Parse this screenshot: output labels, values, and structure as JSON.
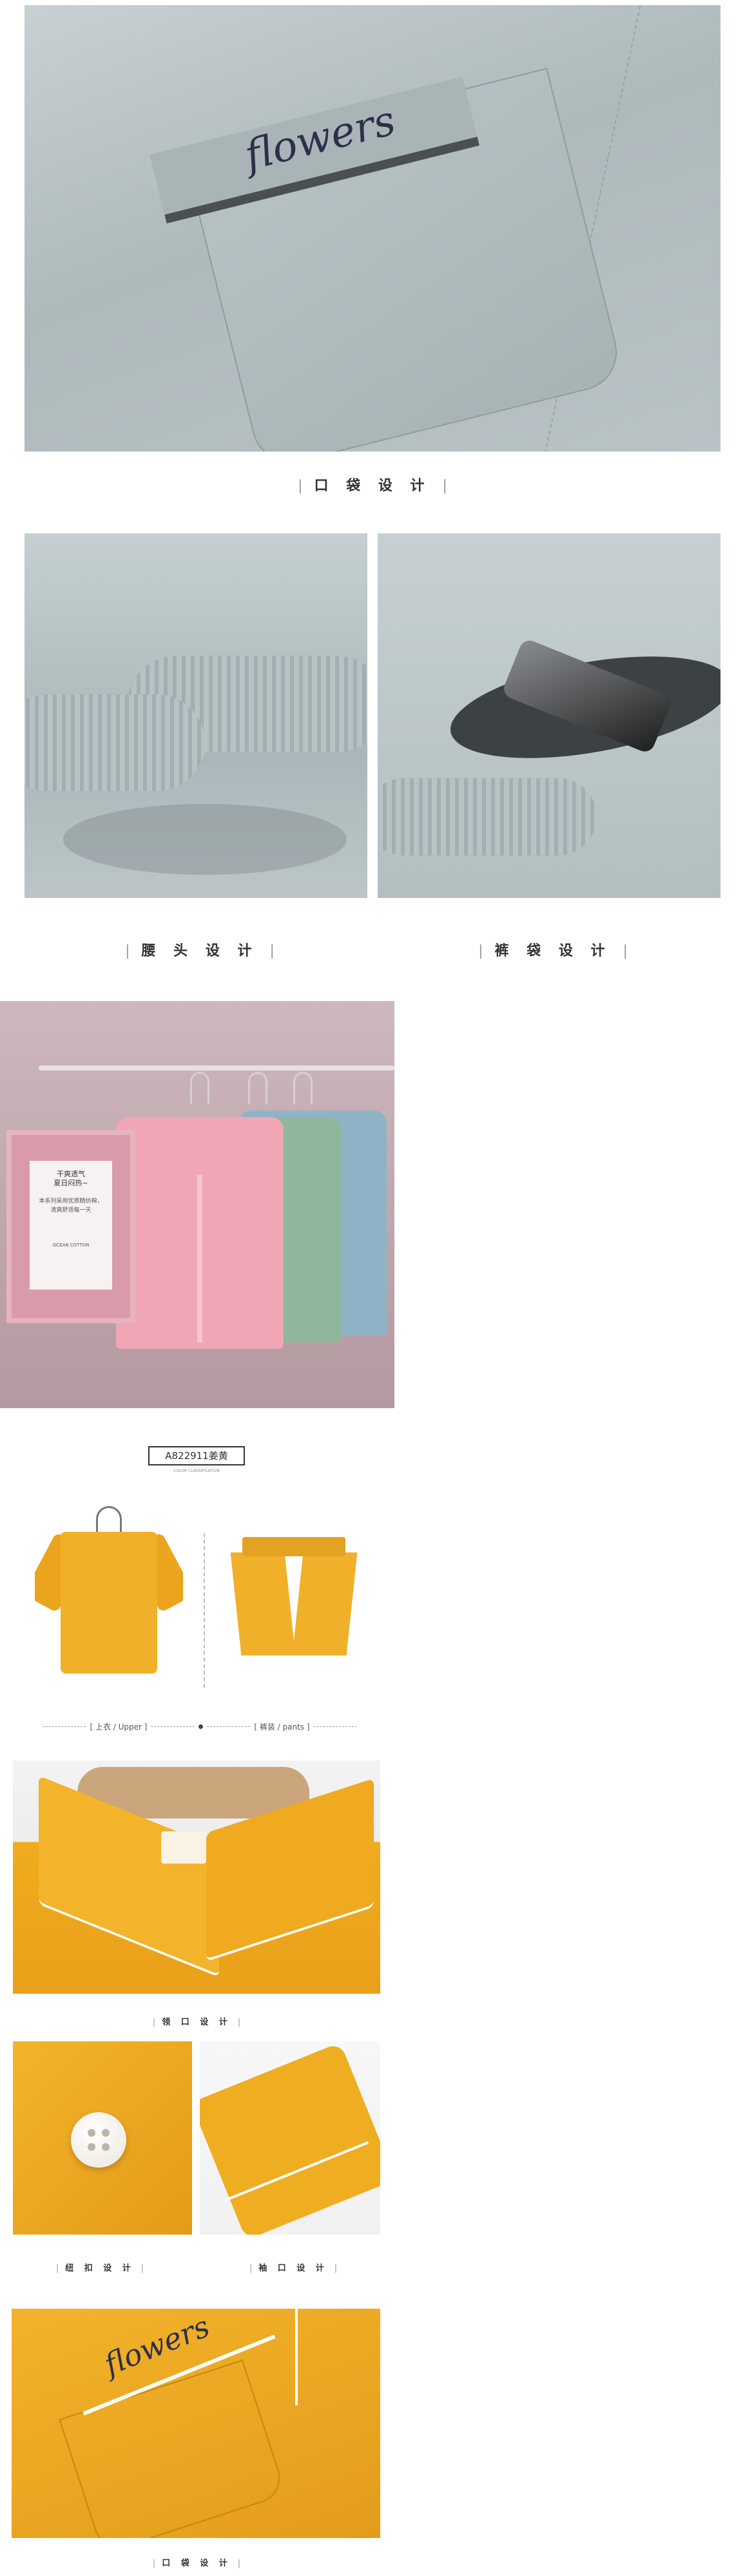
{
  "sections": {
    "pocket_gray": {
      "embroidery": "flowers",
      "caption": "口 袋 设 计"
    },
    "waist_gray": {
      "caption": "腰 头 设 计"
    },
    "side_pocket_gray": {
      "caption": "裤 袋 设 计"
    },
    "hangers": {
      "card_title": "干爽透气",
      "card_title_2": "夏日闷热~",
      "card_line_1": "本系列采用优质精纺棉，",
      "card_line_2": "清爽舒适每一天",
      "card_logo": "OCEAN COTTON"
    },
    "product": {
      "model_code": "A822911姜黄",
      "color_note": "COLOR CLASSIFICATION",
      "upper_label": "[ 上衣 / Upper ]",
      "pants_label": "[ 裤装 / pants ]"
    },
    "collar_yellow": {
      "caption": "领 口 设 计"
    },
    "button_yellow": {
      "caption": "纽 扣 设 计"
    },
    "sleeve_yellow": {
      "caption": "袖 口 设 计"
    },
    "pocket_yellow": {
      "embroidery": "flowers",
      "caption": "口 袋 设 计"
    }
  },
  "colors": {
    "gray_fabric": "#b3bec1",
    "pink_shirt": "#f0a6b5",
    "green_shirt": "#8fb79c",
    "blue_shirt": "#8fb3c6",
    "yellow_fabric": "#efac1e"
  }
}
